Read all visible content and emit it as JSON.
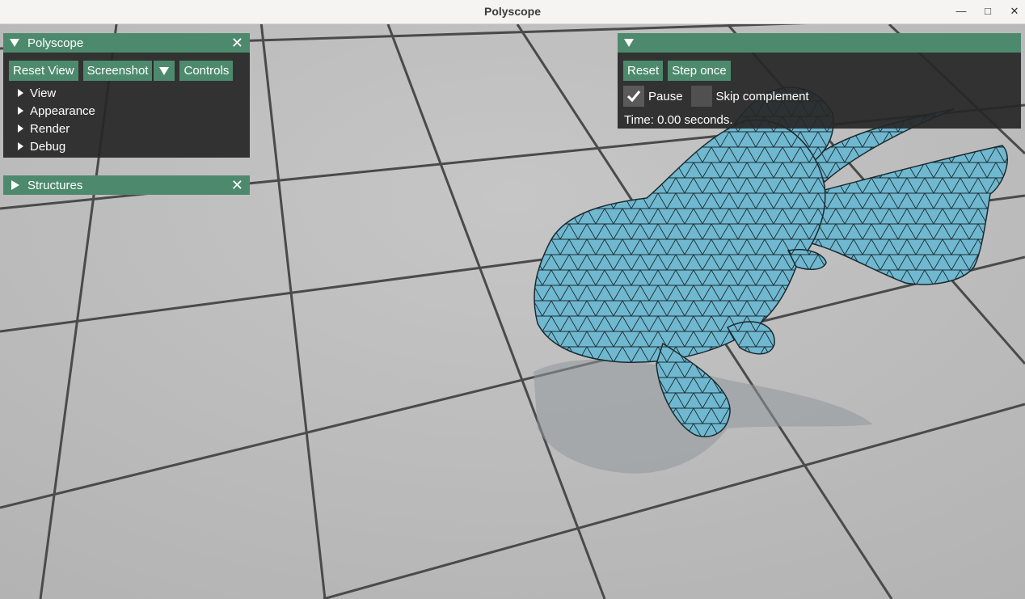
{
  "window": {
    "title": "Polyscope",
    "minimize_glyph": "—",
    "maximize_glyph": "□",
    "close_glyph": "✕"
  },
  "main_panel": {
    "title": "Polyscope",
    "close_glyph": "✕",
    "buttons": {
      "reset_view": "Reset View",
      "screenshot": "Screenshot",
      "controls": "Controls"
    },
    "tree_items": [
      "View",
      "Appearance",
      "Render",
      "Debug"
    ]
  },
  "structures_panel": {
    "title": "Structures",
    "close_glyph": "✕"
  },
  "sim_panel": {
    "title": "",
    "buttons": {
      "reset": "Reset",
      "step_once": "Step once"
    },
    "checkboxes": {
      "pause": {
        "label": "Pause",
        "checked": true
      },
      "skip_complement": {
        "label": "Skip complement",
        "checked": false
      }
    },
    "status": "Time: 0.00 seconds."
  },
  "scene": {
    "object": "fish-mesh",
    "colors": {
      "accent": "#4d8a6d",
      "mesh_fill": "#6fb8cf",
      "mesh_edge": "#1b2a30",
      "floor": "#bebebe",
      "grout": "#4a4a4a"
    }
  }
}
